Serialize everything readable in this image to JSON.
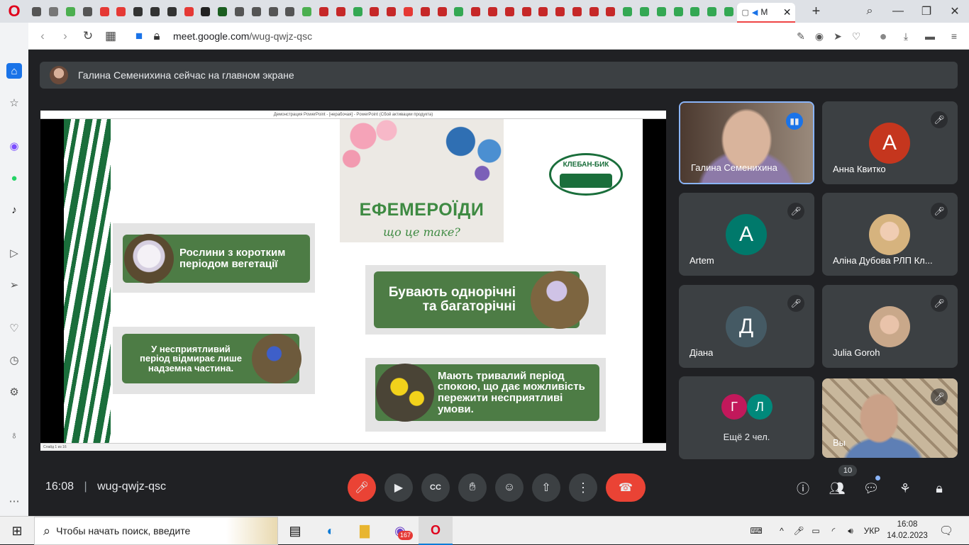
{
  "browser": {
    "active_tab_label": "M",
    "url_host": "meet.google.com",
    "url_path": "/wug-qwjz-qsc",
    "tab_icon_colors": [
      "#555",
      "#777",
      "#4caf50",
      "#555",
      "#e53935",
      "#e53935",
      "#333",
      "#333",
      "#333",
      "#e53935",
      "#222",
      "#1b5e20",
      "#555",
      "#555",
      "#555",
      "#555",
      "#4caf50",
      "#c62828",
      "#c62828",
      "#34a853",
      "#c62828",
      "#c62828",
      "#e53935",
      "#c62828",
      "#c62828",
      "#34a853",
      "#c62828",
      "#c62828",
      "#c62828",
      "#c62828",
      "#c62828",
      "#c62828",
      "#c62828",
      "#c62828",
      "#c62828",
      "#34a853",
      "#34a853",
      "#34a853",
      "#34a853",
      "#34a853",
      "#34a853",
      "#34a853"
    ]
  },
  "meet": {
    "banner_text": "Галина Семенихина сейчас на главном экране",
    "time": "16:08",
    "meeting_code": "wug-qwjz-qsc",
    "participants_count": "10"
  },
  "presentation": {
    "window_title": "Демонстрация PowerPoint - [нерабочая] - PowerPoint (Сбой активации продукта)",
    "status_text": "Слайд 1 из 16",
    "title": "ЕФЕМЕРОЇДИ",
    "subtitle": "що це таке?",
    "logo_text": "КЛЕБАН-БИК",
    "card1": "Рослини з коротким періодом вегетації",
    "card2": "Бувають однорічні та багаторічні",
    "card3": "У несприятливий період відмирає лише надземна частина.",
    "card4": "Мають тривалий період спокою, що дає можливість пережити несприятливі умови."
  },
  "tiles": [
    {
      "name": "Галина Семенихина",
      "type": "video",
      "speaking": true
    },
    {
      "name": "Анна Квитко",
      "letter": "А",
      "color": "#c5361e"
    },
    {
      "name": "Artem",
      "letter": "A",
      "color": "#00796b"
    },
    {
      "name": "Аліна Дубова РЛП Кл...",
      "type": "avatar"
    },
    {
      "name": "Діана",
      "letter": "Д",
      "color": "#455a64"
    },
    {
      "name": "Julia Goroh",
      "type": "avatar"
    },
    {
      "name": "Ещё 2 чел.",
      "letters": [
        "Г",
        "Л"
      ],
      "colors": [
        "#c2185b",
        "#00897b"
      ]
    },
    {
      "name": "Вы",
      "type": "video"
    }
  ],
  "taskbar": {
    "search_placeholder": "Чтобы начать поиск, введите",
    "badge": "167",
    "lang": "УКР",
    "clock_time": "16:08",
    "clock_date": "14.02.2023"
  }
}
